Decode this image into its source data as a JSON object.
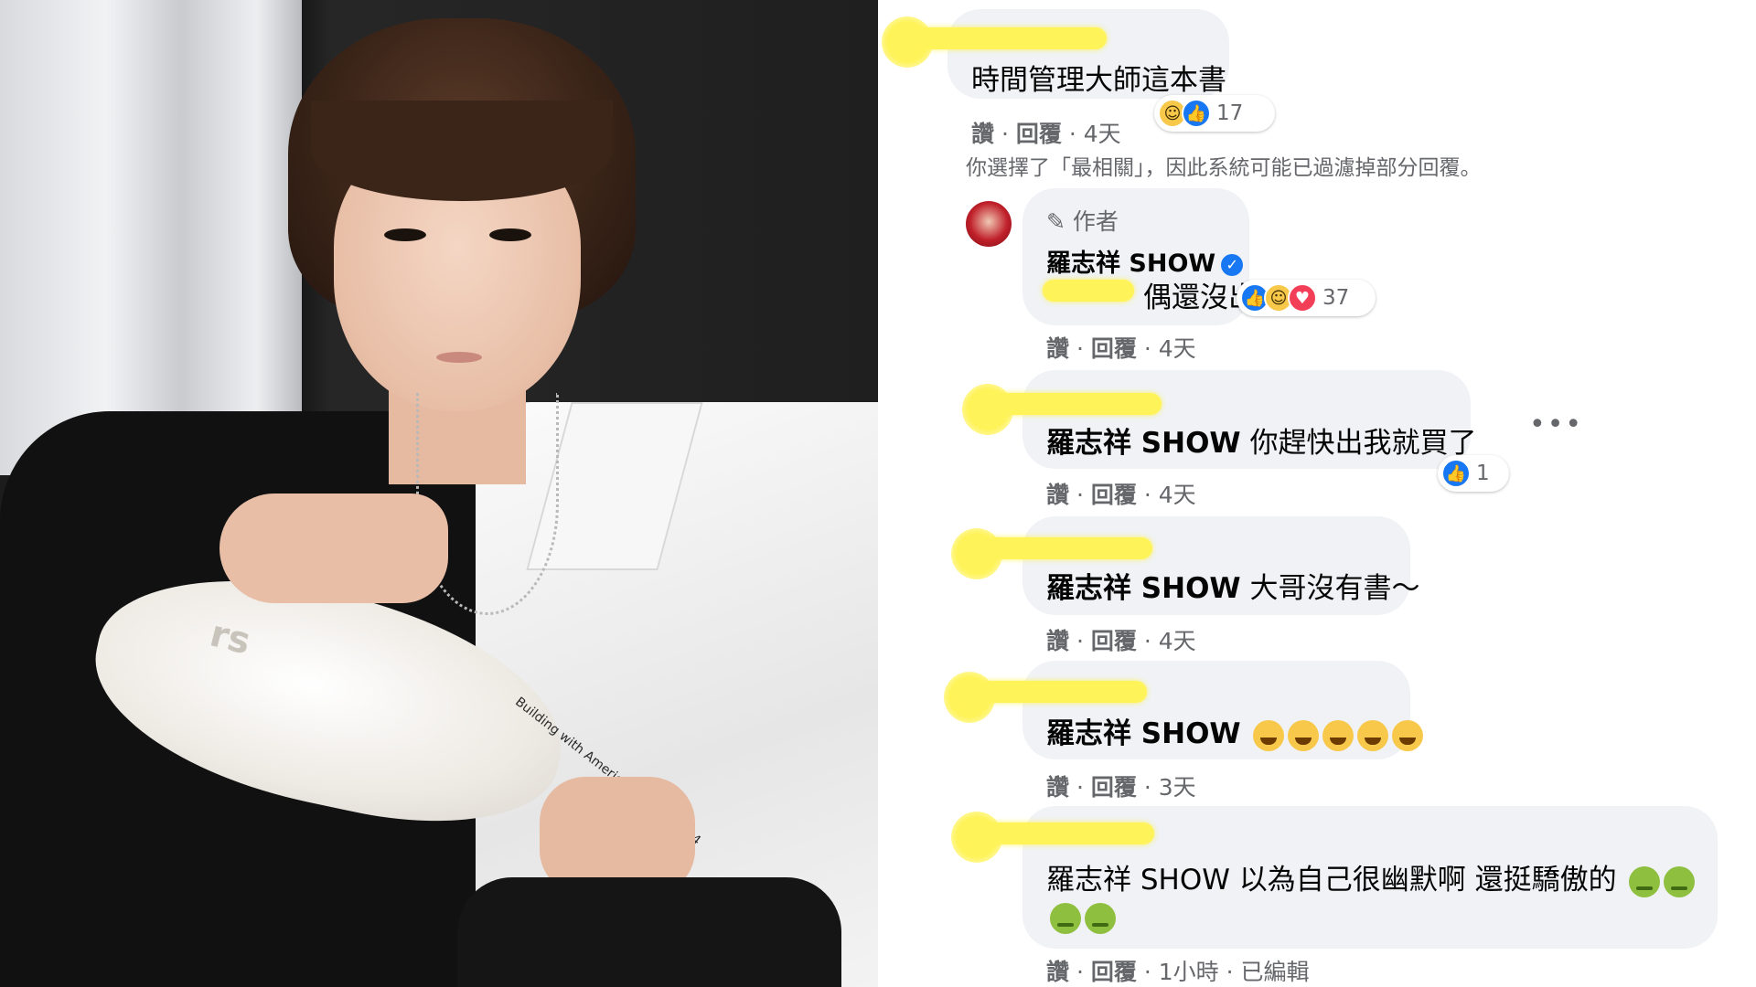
{
  "photo": {
    "shirt_print": "Building with American Flag, c.1984",
    "shoe_logo": "rs"
  },
  "filter_notice": "你選擇了「最相關」，因此系統可能已過濾掉部分回覆。",
  "meta_like": "讚",
  "meta_reply": "回覆",
  "comments": [
    {
      "text": "時間管理大師這本書",
      "time": "4天",
      "reactions": [
        "haha",
        "like"
      ],
      "reaction_count": "17"
    },
    {
      "author_tag": "作者",
      "author": "羅志祥 SHOW",
      "text": "偶還沒出",
      "time": "4天",
      "reactions": [
        "like",
        "haha",
        "love"
      ],
      "reaction_count": "37"
    },
    {
      "mention": "羅志祥 SHOW",
      "text": "你趕快出我就買了",
      "time": "4天",
      "reactions": [
        "like"
      ],
      "reaction_count": "1",
      "more": "•••"
    },
    {
      "mention": "羅志祥 SHOW",
      "text": "大哥沒有書～",
      "time": "4天"
    },
    {
      "mention": "羅志祥 SHOW",
      "emojis": [
        "grin-sweat",
        "laugh",
        "rofl",
        "rofl",
        "rofl"
      ],
      "time": "3天"
    },
    {
      "mention": "羅志祥 SHOW",
      "text": "以為自己很幽默啊 還挺驕傲的",
      "emojis": [
        "nauseated",
        "nauseated",
        "nauseated",
        "nauseated"
      ],
      "time": "1小時",
      "edited": "已編輯"
    }
  ],
  "colors": {
    "bubble": "#f0f2f5",
    "meta": "#65676b",
    "like": "#1877f2",
    "redaction": "#fff35a"
  }
}
